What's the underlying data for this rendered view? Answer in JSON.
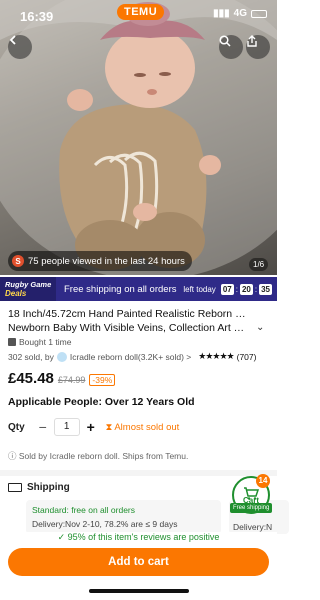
{
  "status_bar": {
    "time": "16:39",
    "network": "4G",
    "battery": ""
  },
  "brand": {
    "logo_text": "TEMU"
  },
  "hero": {
    "viewed_icon_letter": "S",
    "viewed_text": "75 people viewed in the last 24 hours",
    "pager": "1/6"
  },
  "deals_banner": {
    "logo_line1": "Rugby Game",
    "logo_line2": "Deals",
    "text": "Free shipping on all orders",
    "timer_label": "left today",
    "timer": [
      "07",
      "20",
      "35"
    ]
  },
  "product": {
    "title_line1": "18 Inch/45.72cm Hand Painted Realistic Reborn Doll",
    "title_line2": "Newborn Baby With Visible Veins, Collection Art Doll, K",
    "bought": "Bought 1 time",
    "sold": "302 sold, by",
    "store": "Icradle reborn doll(3.2K+ sold) >",
    "stars": "★★★★★",
    "rating_count": "(707)",
    "price": "£45.48",
    "old_price": "£74.99",
    "discount": "-39%",
    "applicable": "Applicable People: Over 12 Years Old",
    "qty_label": "Qty",
    "qty_value": "1",
    "almost_sold": "Almost sold out",
    "sold_by": "Sold by Icradle reborn doll. Ships from Temu."
  },
  "shipping": {
    "heading": "Shipping",
    "standard": "Standard: free on all orders",
    "delivery": "Delivery:Nov 2-10, 78.2% are ≤ 9 days",
    "delivery2": "Delivery:N"
  },
  "cart": {
    "label": "Cart",
    "badge": "14",
    "free_tag": "Free shipping"
  },
  "footer": {
    "reviews": "95% of this item's reviews are positive",
    "add_to_cart": "Add to cart"
  },
  "colors": {
    "accent": "#fb7701",
    "banner": "#2f2a88",
    "success": "#1f8f2e"
  }
}
